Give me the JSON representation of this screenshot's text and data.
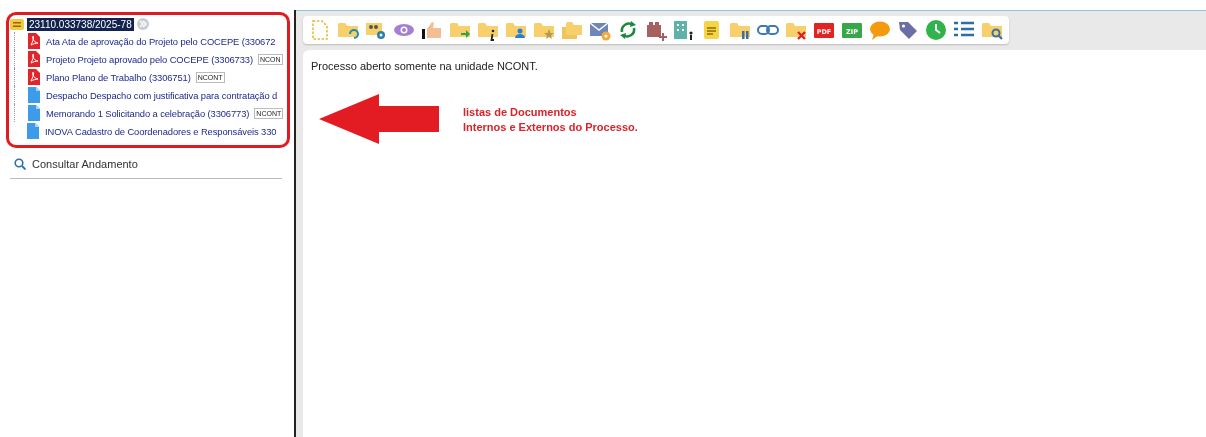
{
  "tree": {
    "process": {
      "number": "23110.033738/2025-78",
      "expanded": true
    },
    "documents": [
      {
        "kind": "pdf",
        "title": "Ata Ata de aprovação do Projeto pelo COCEPE (330672"
      },
      {
        "kind": "pdf",
        "title": "Projeto Projeto aprovado pelo COCEPE (3306733)",
        "badge": "NCON"
      },
      {
        "kind": "pdf",
        "title": "Plano Plano de Trabalho (3306751)",
        "badge": "NCONT"
      },
      {
        "kind": "doc",
        "title": "Despacho Despacho com justificativa para contratação d"
      },
      {
        "kind": "doc",
        "title": "Memorando 1 Solicitando a celebração (3306773)",
        "badge": "NCONT"
      },
      {
        "kind": "doc",
        "title": "INOVA Cadastro de Coordenadores e Responsáveis 330"
      }
    ]
  },
  "consult_link": "Consultar Andamento",
  "toolbar": {
    "pdf_icon_text": "PDF",
    "zip_icon_text": "ZIP"
  },
  "content": {
    "message": "Processo aberto somente na unidade NCONT."
  },
  "annotation": {
    "lines": [
      "listas de Documentos",
      "Internos e Externos do Processo."
    ]
  }
}
